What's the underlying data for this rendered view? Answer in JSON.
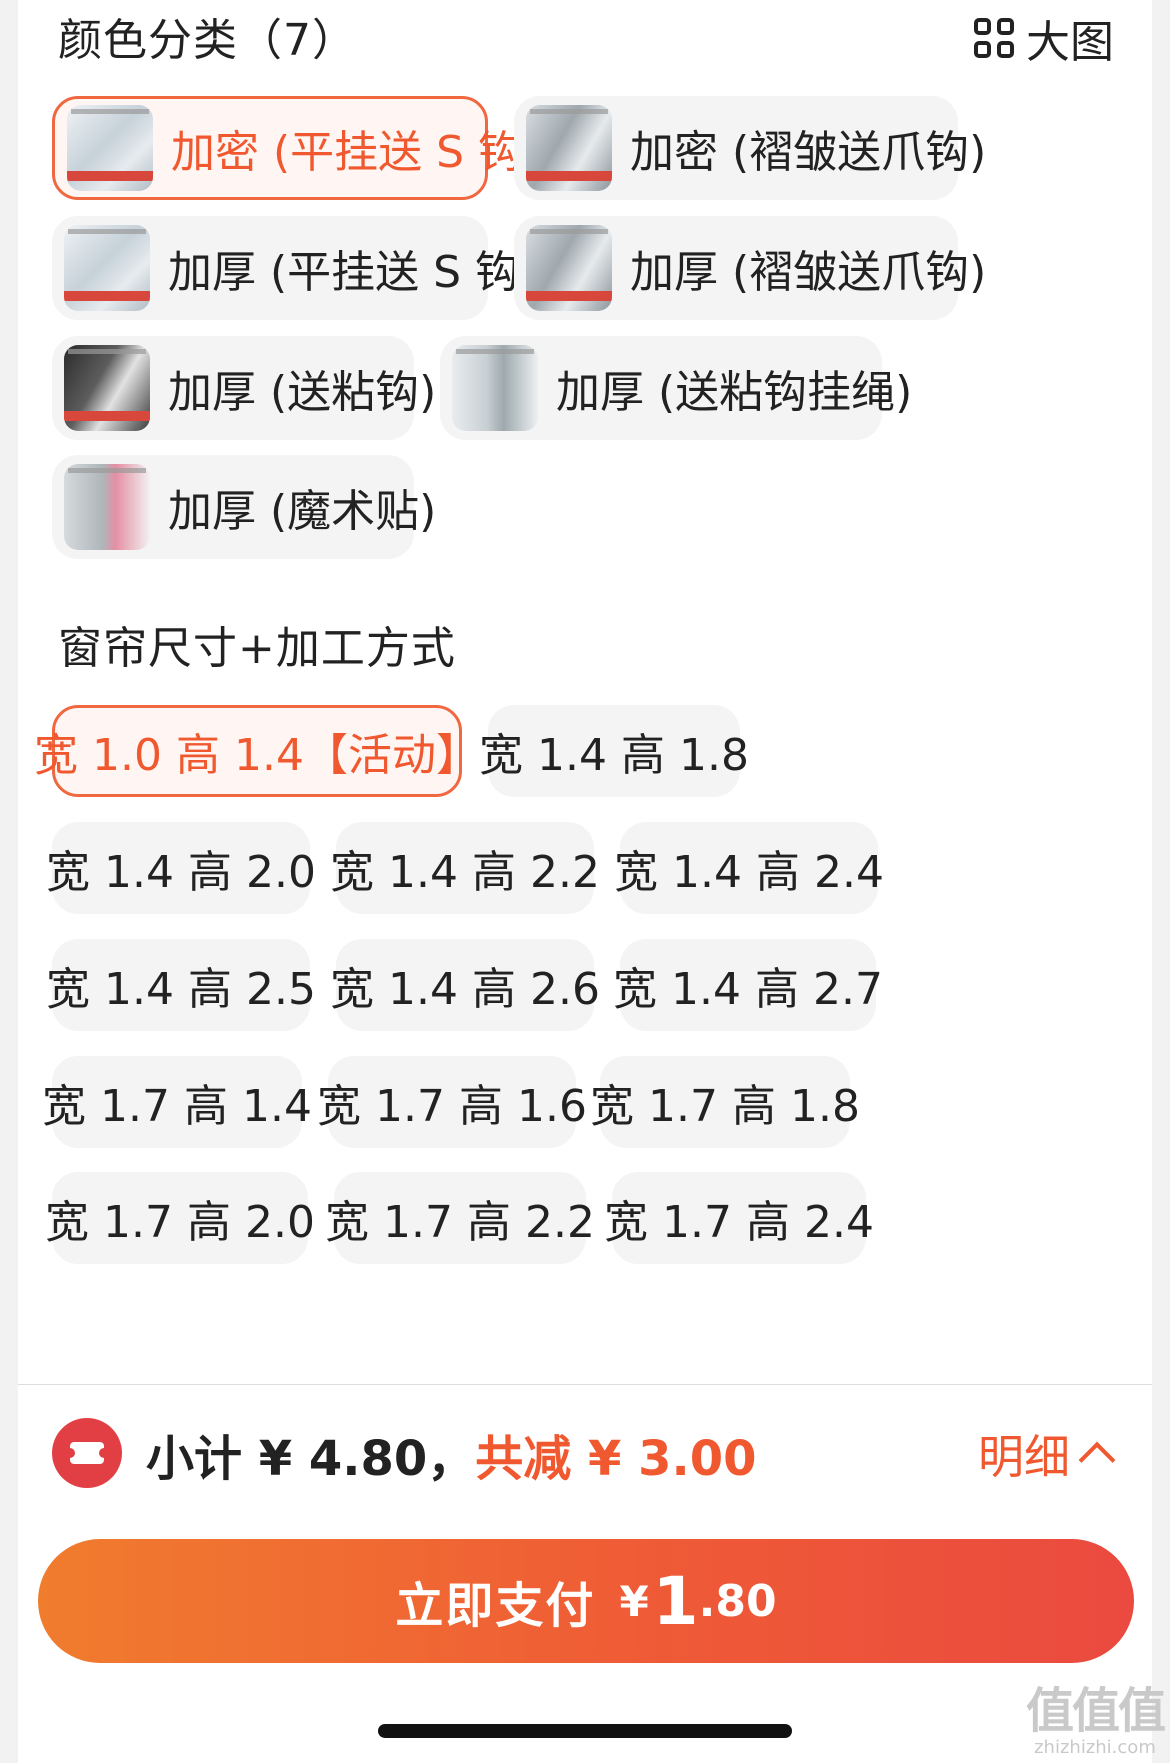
{
  "colors": {
    "accent": "#f0582f",
    "selected_bg": "#fff6f3",
    "chip_bg": "#f4f4f4",
    "pay_start": "#f07c2e",
    "pay_end": "#ea4a3f",
    "coupon": "#e23f45"
  },
  "color_section": {
    "title": "颜色分类（7）",
    "big_view_label": "大图",
    "big_view_icon": "grid-icon",
    "options": [
      {
        "label": "加密 (平挂送 S 钩)",
        "selected": true
      },
      {
        "label": "加密 (褶皱送爪钩)",
        "selected": false
      },
      {
        "label": "加厚 (平挂送 S 钩)",
        "selected": false
      },
      {
        "label": "加厚 (褶皱送爪钩)",
        "selected": false
      },
      {
        "label": "加厚 (送粘钩)",
        "selected": false
      },
      {
        "label": "加厚 (送粘钩挂绳)",
        "selected": false
      },
      {
        "label": "加厚 (魔术贴)",
        "selected": false
      }
    ]
  },
  "size_section": {
    "title": "窗帘尺寸+加工方式",
    "options": [
      "宽 1.0 高 1.4【活动】",
      "宽 1.4 高 1.8",
      "宽 1.4 高 2.0",
      "宽 1.4 高 2.2",
      "宽 1.4 高 2.4",
      "宽 1.4 高 2.5",
      "宽 1.4 高 2.6",
      "宽 1.4 高 2.7",
      "宽 1.7 高 1.4",
      "宽 1.7 高 1.6",
      "宽 1.7 高 1.8",
      "宽 1.7 高 2.0",
      "宽 1.7 高 2.2",
      "宽 1.7 高 2.4"
    ],
    "selected": "宽 1.0 高 1.4【活动】"
  },
  "bottom_bar": {
    "subtotal": "小计 ¥ 4.80，",
    "discount": "共减 ¥ 3.00",
    "detail_label": "明细",
    "pay_label": "立即支付",
    "pay_currency": "¥",
    "pay_integer": "1",
    "pay_decimal": ".80"
  },
  "watermark": {
    "line1": "值值值",
    "line2": "zhizhizhi.com"
  }
}
